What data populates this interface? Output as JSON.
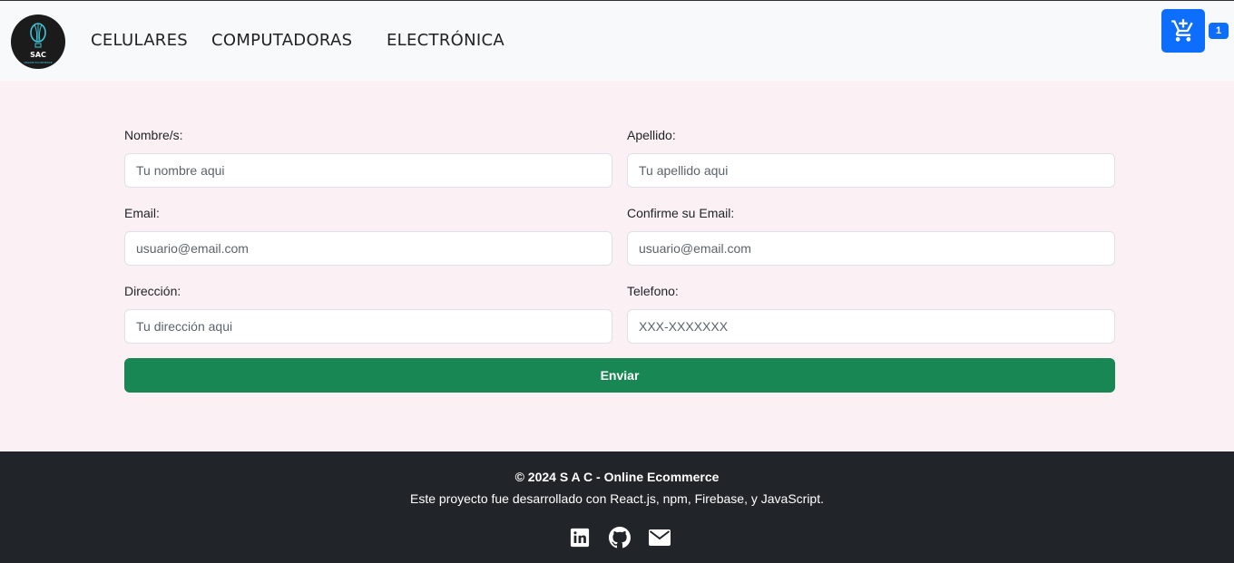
{
  "header": {
    "logo": {
      "text": "SAC",
      "subtext": "ONLINE ECOMMERCE"
    },
    "nav": [
      "CELULARES",
      "COMPUTADORAS",
      "ELECTRÓNICA"
    ],
    "cart": {
      "icon": "cart-plus-icon",
      "count": "1",
      "accent": "#0d6efd"
    }
  },
  "form": {
    "nombre": {
      "label": "Nombre/s:",
      "placeholder": "Tu nombre aqui"
    },
    "apellido": {
      "label": "Apellido:",
      "placeholder": "Tu apellido aqui"
    },
    "email": {
      "label": "Email:",
      "placeholder": "usuario@email.com"
    },
    "confirm_email": {
      "label": "Confirme su Email:",
      "placeholder": "usuario@email.com"
    },
    "direccion": {
      "label": "Dirección:",
      "placeholder": "Tu dirección aqui"
    },
    "telefono": {
      "label": "Telefono:",
      "placeholder": "XXX-XXXXXXX"
    },
    "submit_label": "Enviar",
    "submit_color": "#198754",
    "background": "#fbf0f4"
  },
  "footer": {
    "copyright": "© 2024 S A C - Online Ecommerce",
    "credits": "Este proyecto fue desarrollado con React.js, npm, Firebase, y JavaScript.",
    "social": [
      "linkedin-icon",
      "github-icon",
      "email-icon"
    ],
    "background": "#212529"
  }
}
